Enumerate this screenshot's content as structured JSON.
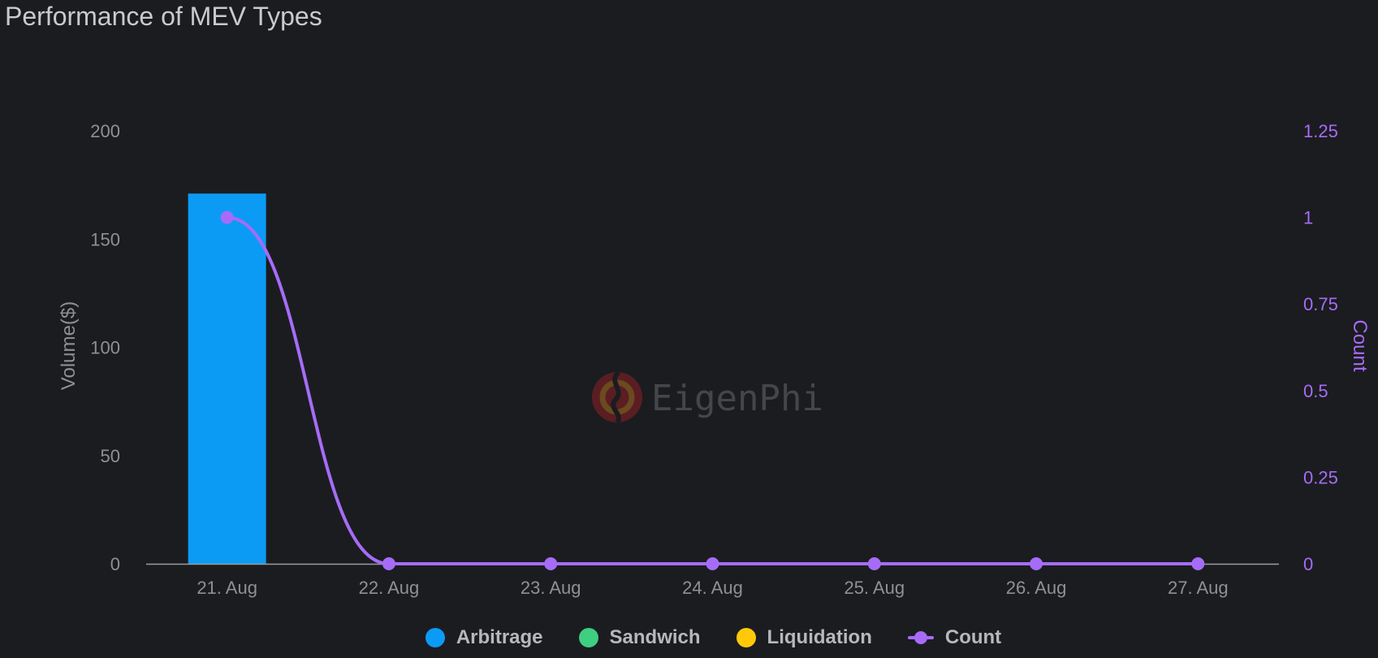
{
  "title": "Performance of MEV Types",
  "watermark": "EigenPhi",
  "colors": {
    "background": "#1b1c20",
    "arbitrage": "#0b9bf5",
    "sandwich": "#3ecf81",
    "liquidation": "#ffc90a",
    "count": "#a66cf7",
    "axis_text": "#8f9094",
    "right_axis_text": "#a66cf7",
    "axis_line": "#9a9b9f"
  },
  "legend": [
    {
      "label": "Arbitrage",
      "color": "#0b9bf5",
      "kind": "dot"
    },
    {
      "label": "Sandwich",
      "color": "#3ecf81",
      "kind": "dot"
    },
    {
      "label": "Liquidation",
      "color": "#ffc90a",
      "kind": "dot"
    },
    {
      "label": "Count",
      "color": "#a66cf7",
      "kind": "line"
    }
  ],
  "chart_data": {
    "type": "bar",
    "title": "Performance of MEV Types",
    "categories": [
      "21. Aug",
      "22. Aug",
      "23. Aug",
      "24. Aug",
      "25. Aug",
      "26. Aug",
      "27. Aug"
    ],
    "series": [
      {
        "name": "Arbitrage",
        "type": "bar",
        "axis": "left",
        "values": [
          171,
          0,
          0,
          0,
          0,
          0,
          0
        ]
      },
      {
        "name": "Sandwich",
        "type": "bar",
        "axis": "left",
        "values": [
          0,
          0,
          0,
          0,
          0,
          0,
          0
        ]
      },
      {
        "name": "Liquidation",
        "type": "bar",
        "axis": "left",
        "values": [
          0,
          0,
          0,
          0,
          0,
          0,
          0
        ]
      },
      {
        "name": "Count",
        "type": "line",
        "axis": "right",
        "values": [
          1,
          0,
          0,
          0,
          0,
          0,
          0
        ]
      }
    ],
    "ylabel": "Volume($)",
    "ylabel_right": "Count",
    "ylim": [
      0,
      200
    ],
    "ylim_right": [
      0,
      1.25
    ],
    "yticks": [
      "0",
      "50",
      "100",
      "150",
      "200"
    ],
    "yticks_right": [
      "0",
      "0.25",
      "0.5",
      "0.75",
      "1",
      "1.25"
    ],
    "grid": false,
    "legend_position": "bottom"
  }
}
